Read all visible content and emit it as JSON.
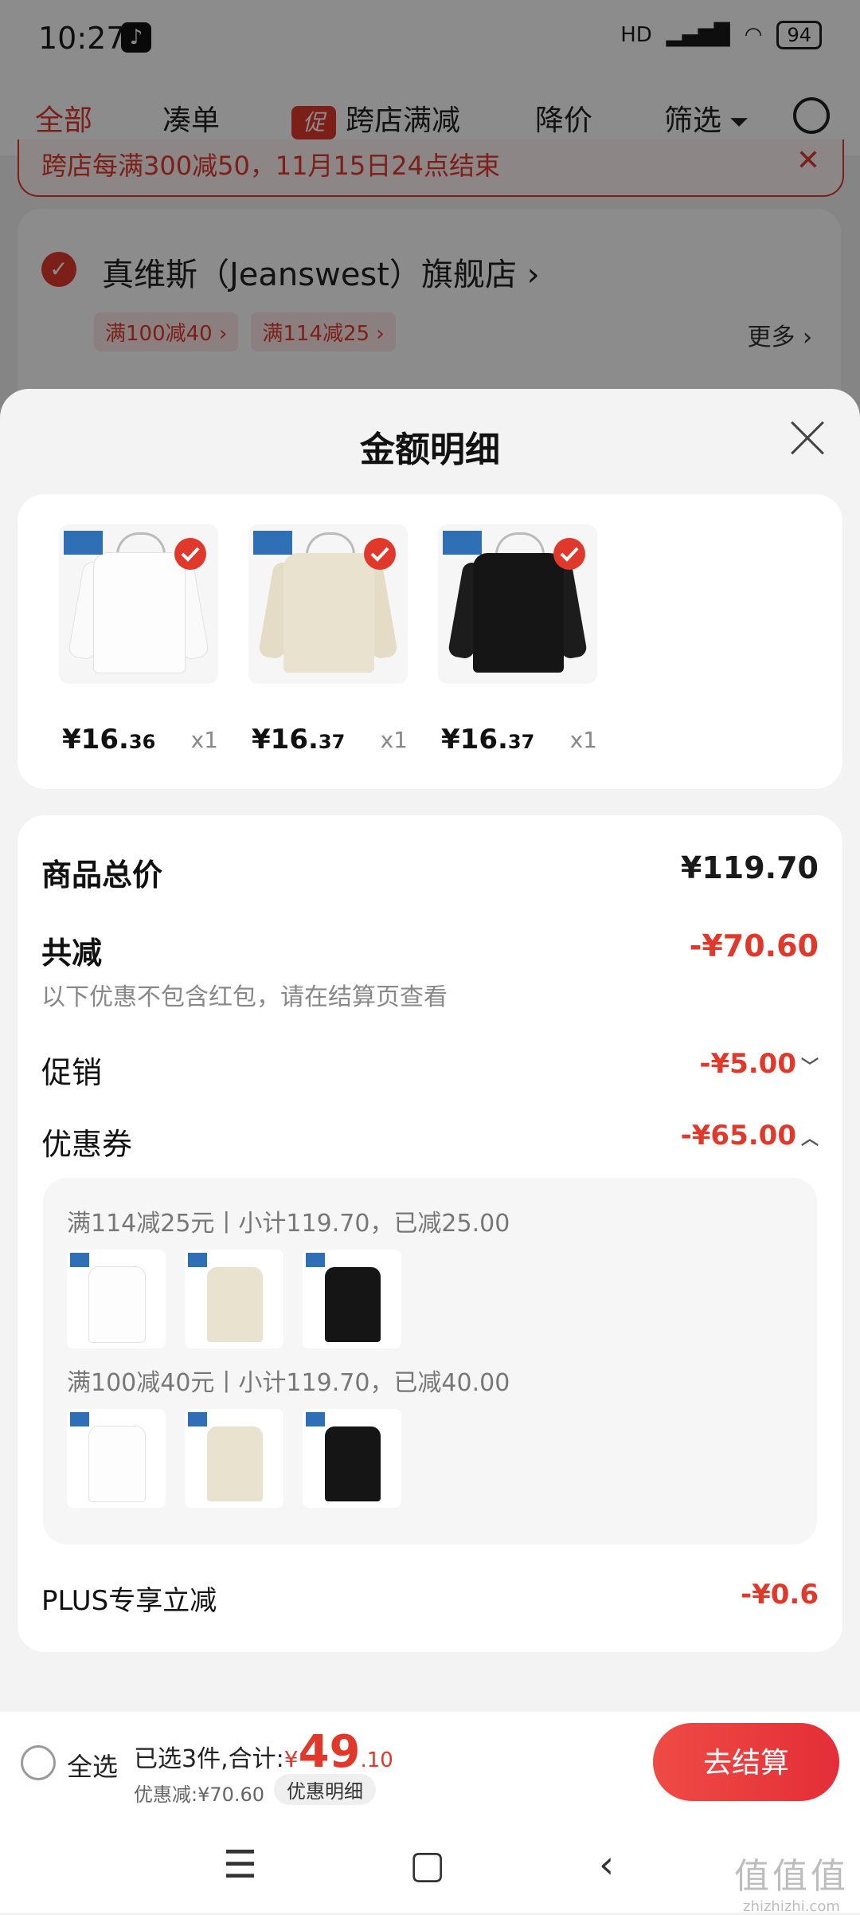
{
  "status_bar": {
    "time": "10:27",
    "network": "HD",
    "battery": "94"
  },
  "top_nav": {
    "items": [
      "全部",
      "凑单",
      "跨店满减",
      "降价",
      "筛选"
    ],
    "promo_badge": "促"
  },
  "notice": {
    "text": "跨店每满300减50，11月15日24点结束",
    "close": "✕"
  },
  "store": {
    "name": "真维斯（Jeanswest）旗舰店 ›",
    "tags": [
      "满100减40 ›",
      "满114减25 ›"
    ],
    "more": "更多 ›"
  },
  "sheet": {
    "title": "金额明细",
    "products": [
      {
        "price_int": "¥16.",
        "price_dec": "36",
        "qty": "x1",
        "color": "#ffffff"
      },
      {
        "price_int": "¥16.",
        "price_dec": "37",
        "qty": "x1",
        "color": "#e9e2cf"
      },
      {
        "price_int": "¥16.",
        "price_dec": "37",
        "qty": "x1",
        "color": "#151515"
      }
    ],
    "total_label": "商品总价",
    "total_value": "¥119.70",
    "reduction_label": "共减",
    "reduction_value": "-¥70.60",
    "reduction_hint": "以下优惠不包含红包，请在结算页查看",
    "promo_label": "促销",
    "promo_value": "-¥5.00",
    "coupon_label": "优惠券",
    "coupon_value": "-¥65.00",
    "coupon_lines": [
      "满114减25元丨小计119.70，已减25.00",
      "满100减40元丨小计119.70，已减40.00"
    ],
    "plus_label": "PLUS专享立减",
    "plus_value": "-¥0.6"
  },
  "bottom_bar": {
    "select_all": "全选",
    "selected_text": "已选3件,合计:",
    "yen": "¥",
    "total_int": "49",
    "total_dec": ".10",
    "saved": "优惠减:¥70.60",
    "detail_chip": "优惠明细",
    "checkout": "去结算"
  },
  "watermark": {
    "top": "值值值",
    "bottom": "zhizhizhi.com"
  },
  "colors": {
    "accent": "#e0392c",
    "sheet_bg": "#f3f3f4"
  }
}
